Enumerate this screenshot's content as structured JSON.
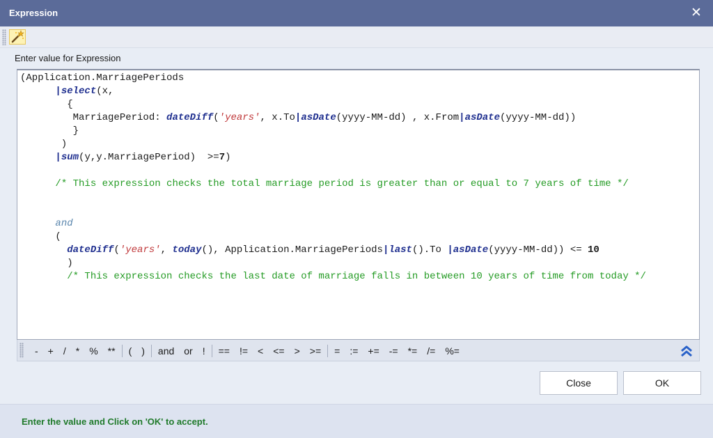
{
  "window": {
    "title": "Expression",
    "close_glyph": "✕"
  },
  "toolbar": {
    "icon": "magic-wand-icon"
  },
  "field": {
    "label": "Enter value for Expression"
  },
  "editor": {
    "lines": [
      [
        {
          "t": "(Application.MarriagePeriods"
        }
      ],
      [
        {
          "t": "      "
        },
        {
          "t": "|",
          "c": "pipe"
        },
        {
          "t": "select",
          "c": "fn"
        },
        {
          "t": "(x,"
        }
      ],
      [
        {
          "t": "        {"
        }
      ],
      [
        {
          "t": "         MarriagePeriod: "
        },
        {
          "t": "dateDiff",
          "c": "fn"
        },
        {
          "t": "("
        },
        {
          "t": "'years'",
          "c": "str"
        },
        {
          "t": ", x.To"
        },
        {
          "t": "|",
          "c": "pipe"
        },
        {
          "t": "asDate",
          "c": "fn"
        },
        {
          "t": "(yyyy-MM-dd) , x.From"
        },
        {
          "t": "|",
          "c": "pipe"
        },
        {
          "t": "asDate",
          "c": "fn"
        },
        {
          "t": "(yyyy-MM-dd))"
        }
      ],
      [
        {
          "t": "         }"
        }
      ],
      [
        {
          "t": "       )"
        }
      ],
      [
        {
          "t": "      "
        },
        {
          "t": "|",
          "c": "pipe"
        },
        {
          "t": "sum",
          "c": "fn"
        },
        {
          "t": "(y,y.MarriagePeriod)  >="
        },
        {
          "t": "7",
          "c": "num"
        },
        {
          "t": ")"
        }
      ],
      [
        {
          "t": ""
        }
      ],
      [
        {
          "t": "      "
        },
        {
          "t": "/* This expression checks the total marriage period is greater than or equal to 7 years of time */",
          "c": "com"
        }
      ],
      [
        {
          "t": ""
        }
      ],
      [
        {
          "t": ""
        }
      ],
      [
        {
          "t": "      "
        },
        {
          "t": "and",
          "c": "kw"
        }
      ],
      [
        {
          "t": "      ("
        }
      ],
      [
        {
          "t": "        "
        },
        {
          "t": "dateDiff",
          "c": "fn"
        },
        {
          "t": "("
        },
        {
          "t": "'years'",
          "c": "str"
        },
        {
          "t": ", "
        },
        {
          "t": "today",
          "c": "fn"
        },
        {
          "t": "(), Application.MarriagePeriods"
        },
        {
          "t": "|",
          "c": "pipe"
        },
        {
          "t": "last",
          "c": "fn"
        },
        {
          "t": "().To "
        },
        {
          "t": "|",
          "c": "pipe"
        },
        {
          "t": "asDate",
          "c": "fn"
        },
        {
          "t": "(yyyy-MM-dd)) <= "
        },
        {
          "t": "10",
          "c": "num"
        }
      ],
      [
        {
          "t": "        )"
        }
      ],
      [
        {
          "t": "        "
        },
        {
          "t": "/* This expression checks the last date of marriage falls in between 10 years of time from today */",
          "c": "com"
        }
      ]
    ]
  },
  "operators": {
    "groups": [
      [
        "-",
        "+",
        "/",
        "*",
        "%",
        "**"
      ],
      [
        "(",
        ")"
      ],
      [
        "and",
        "or",
        "!"
      ],
      [
        "==",
        "!=",
        "<",
        "<=",
        ">",
        ">="
      ],
      [
        "=",
        ":=",
        "+=",
        "-=",
        "*=",
        "/=",
        "%="
      ]
    ],
    "collapse_icon": "double-chevron-up-icon"
  },
  "buttons": {
    "close_label": "Close",
    "ok_label": "OK"
  },
  "status": {
    "message": "Enter the value and Click on 'OK' to accept."
  },
  "colors": {
    "title_bar": "#5b6b99",
    "function": "#1f2f8f",
    "string": "#c0393b",
    "comment": "#249b24",
    "keyword": "#5a86ad",
    "status_text": "#1f7a2a"
  }
}
